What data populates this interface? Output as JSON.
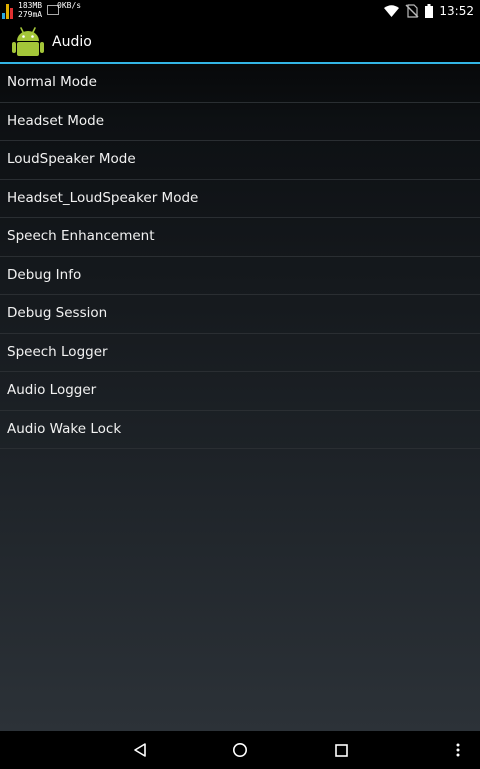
{
  "status_bar": {
    "memory": "183MB",
    "current": "279mA",
    "net_speed": "0KB/s",
    "time": "13:52",
    "icons": [
      "wifi-icon",
      "no-sim-icon",
      "battery-icon"
    ]
  },
  "action_bar": {
    "title": "Audio",
    "icon": "android-robot-icon",
    "accent_color": "#33b5e5"
  },
  "menu": {
    "items": [
      "Normal Mode",
      "Headset Mode",
      "LoudSpeaker Mode",
      "Headset_LoudSpeaker Mode",
      "Speech Enhancement",
      "Debug Info",
      "Debug Session",
      "Speech Logger",
      "Audio Logger",
      "Audio Wake Lock"
    ]
  },
  "nav_bar": {
    "buttons": [
      "back-icon",
      "home-icon",
      "recents-icon",
      "overflow-menu-icon"
    ]
  }
}
